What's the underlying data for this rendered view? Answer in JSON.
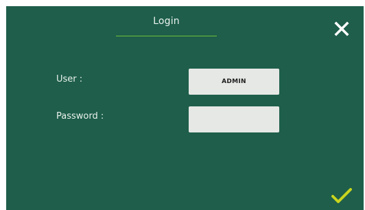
{
  "dialog": {
    "title": "Login"
  },
  "form": {
    "user_label": "User :",
    "user_value": "ADMIN",
    "password_label": "Password :",
    "password_value": ""
  },
  "icons": {
    "close": "close-icon",
    "confirm": "checkmark-icon"
  },
  "colors": {
    "background": "#1e5e4a",
    "accent": "#6fbf3e",
    "confirm": "#c8d41e",
    "text": "#eaf3ef",
    "field": "#e6e8e5"
  }
}
